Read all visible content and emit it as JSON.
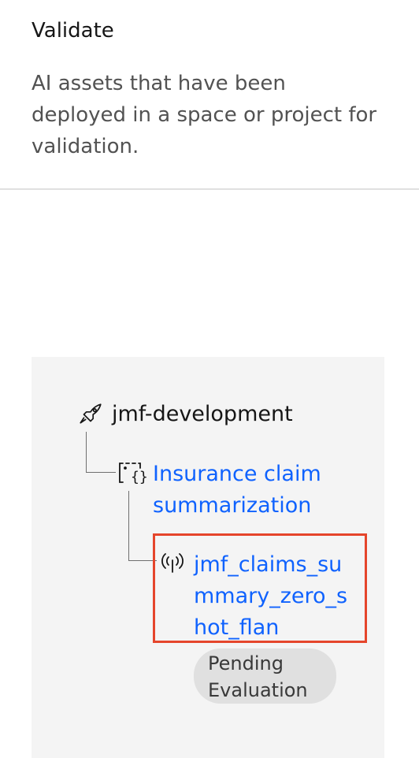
{
  "header": {
    "title": "Validate",
    "description": "AI assets that have been deployed in a space or project for validation."
  },
  "lineage": {
    "space": {
      "label": "jmf-development",
      "icon": "rocket-icon"
    },
    "asset": {
      "label": "Insurance claim summarization",
      "icon": "prompt-template-icon"
    },
    "deployment": {
      "label": "jmf_claims_summary_zero_shot_flan",
      "icon": "deployment-icon"
    },
    "status": {
      "label": "Pending Evaluation"
    }
  },
  "colors": {
    "link": "#0f62fe",
    "highlight": "#e5452b",
    "card_bg": "#f4f4f4",
    "tag_bg": "#e0e0e0"
  }
}
